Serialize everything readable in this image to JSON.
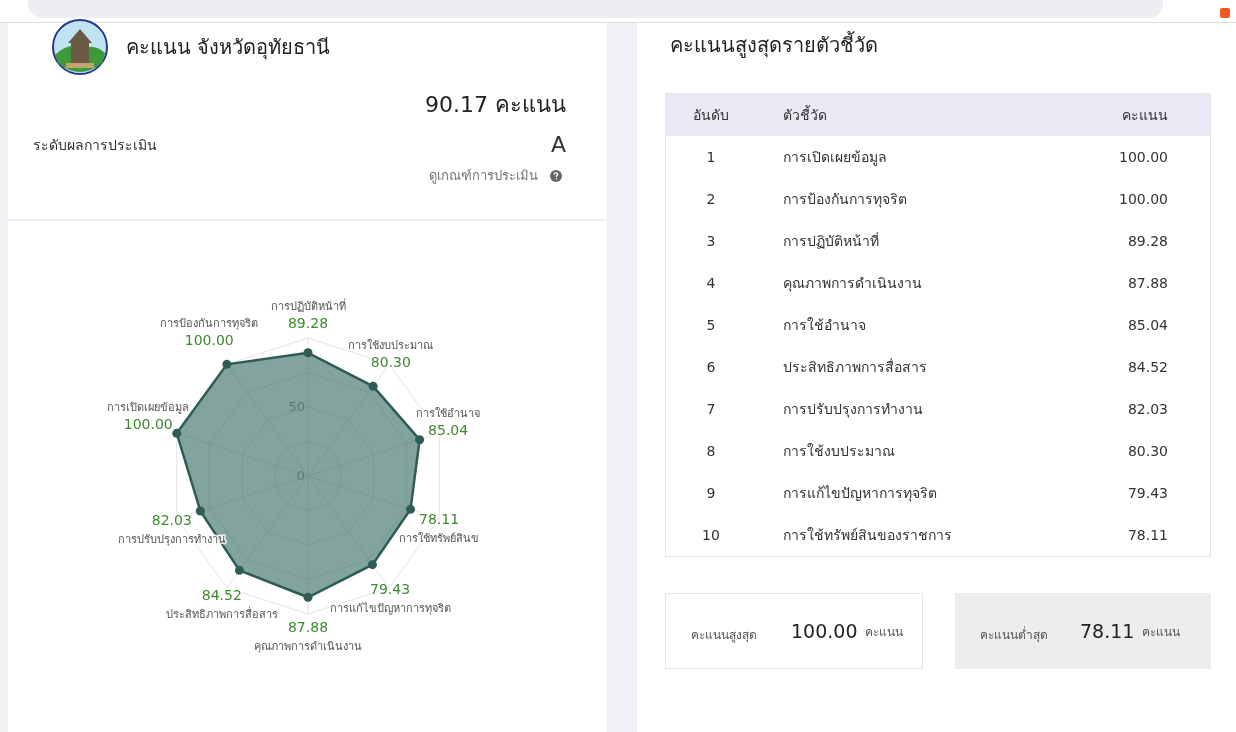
{
  "left_panel": {
    "title": "คะแนน จังหวัดอุทัยธานี",
    "total_score": "90.17 คะแนน",
    "grade_label": "ระดับผลการประเมิน",
    "grade": "A",
    "criteria_link": "ดูเกณฑ์การประเมิน",
    "chart_data": {
      "type": "radar",
      "categories": [
        "การปฏิบัติหน้าที่",
        "การใช้งบประมาณ",
        "การใช้อำนาจ",
        "การใช้ทรัพย์สินข",
        "การแก้ไขปัญหาการทุจริต",
        "คุณภาพการดำเนินงาน",
        "ประสิทธิภาพการสื่อสาร",
        "การปรับปรุงการทำงาน",
        "การเปิดเผยข้อมูล",
        "การป้องกันการทุจริต"
      ],
      "values": [
        89.28,
        80.3,
        85.04,
        78.11,
        79.43,
        87.88,
        84.52,
        82.03,
        100.0,
        100.0
      ],
      "ylim": [
        0,
        100
      ],
      "yticks": [
        0,
        50
      ],
      "data_labels": true,
      "value_labels": [
        "89.28",
        "80.30",
        "85.04",
        "78.11",
        "79.43",
        "87.88",
        "84.52",
        "82.03",
        "100.00",
        "100.00"
      ]
    }
  },
  "right_panel": {
    "title": "คะแนนสูงสุดรายตัวชี้วัด",
    "table": {
      "columns": [
        "อันดับ",
        "ตัวชี้วัด",
        "คะแนน"
      ],
      "rows": [
        [
          "1",
          "การเปิดเผยข้อมูล",
          "100.00"
        ],
        [
          "2",
          "การป้องกันการทุจริต",
          "100.00"
        ],
        [
          "3",
          "การปฏิบัติหน้าที่",
          "89.28"
        ],
        [
          "4",
          "คุณภาพการดำเนินงาน",
          "87.88"
        ],
        [
          "5",
          "การใช้อำนาจ",
          "85.04"
        ],
        [
          "6",
          "ประสิทธิภาพการสื่อสาร",
          "84.52"
        ],
        [
          "7",
          "การปรับปรุงการทำงาน",
          "82.03"
        ],
        [
          "8",
          "การใช้งบประมาณ",
          "80.30"
        ],
        [
          "9",
          "การแก้ไขปัญหาการทุจริต",
          "79.43"
        ],
        [
          "10",
          "การใช้ทรัพย์สินของราชการ",
          "78.11"
        ]
      ]
    },
    "summary": [
      {
        "kind": "max",
        "label": "คะแนนสูงสุด",
        "value": "100.00",
        "unit": "คะแนน"
      },
      {
        "kind": "min",
        "label": "คะแนนต่ำสุด",
        "value": "78.11",
        "unit": "คะแนน"
      }
    ]
  }
}
